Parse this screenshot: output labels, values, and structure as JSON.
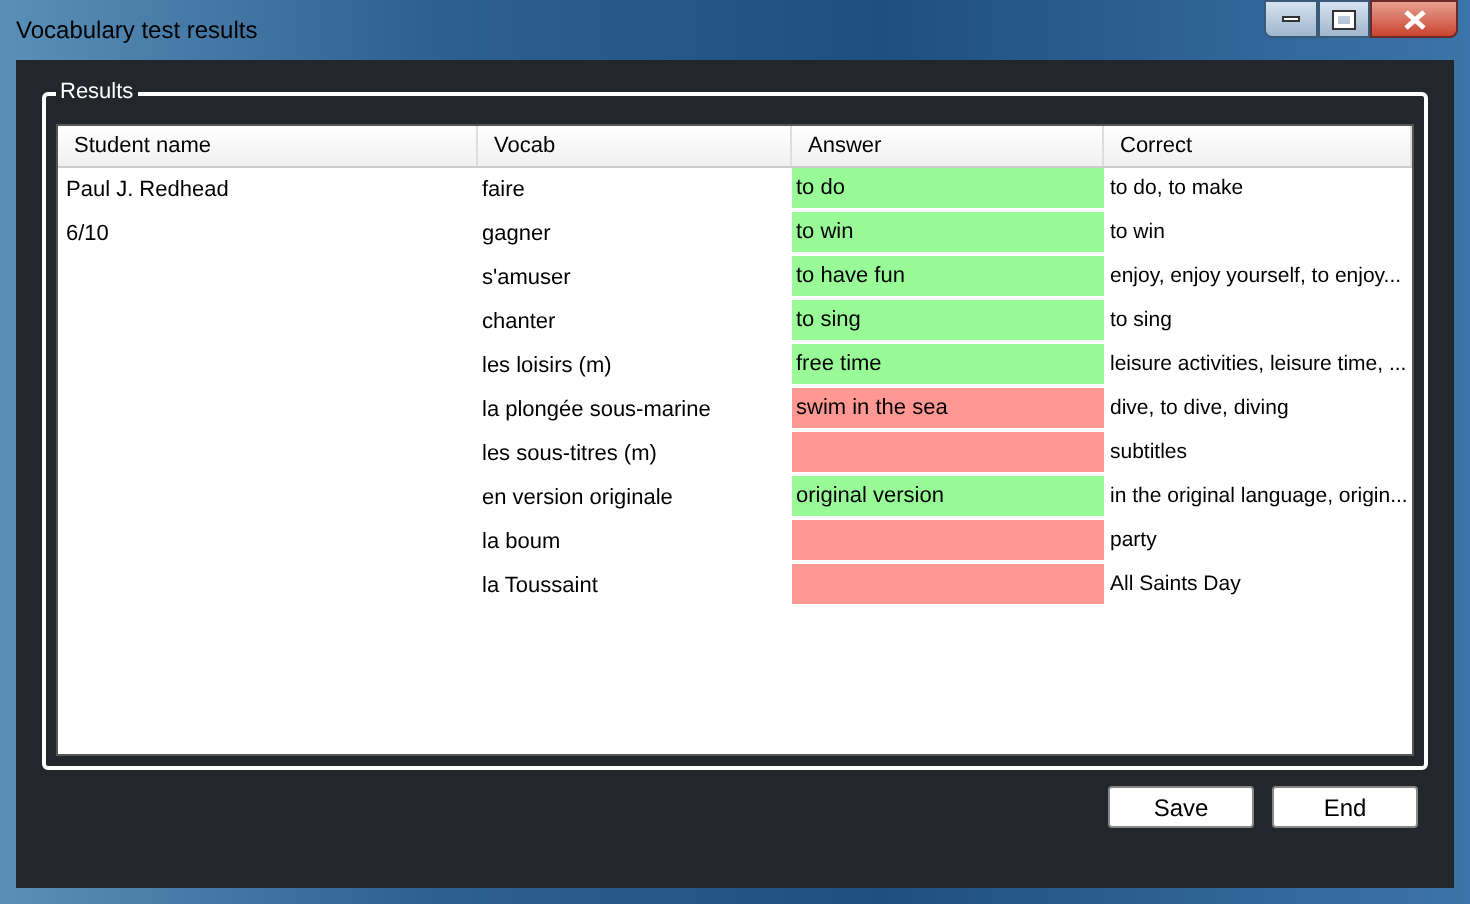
{
  "window": {
    "title": "Vocabulary test results"
  },
  "group": {
    "label": "Results"
  },
  "table": {
    "columns": [
      "Student name",
      "Vocab",
      "Answer",
      "Correct"
    ],
    "rows": [
      {
        "student": "Paul J. Redhead",
        "vocab": "faire",
        "answer": "to do",
        "correct": true,
        "expected": "to do, to make"
      },
      {
        "student": "6/10",
        "vocab": "gagner",
        "answer": "to win",
        "correct": true,
        "expected": "to win"
      },
      {
        "vocab": "s'amuser",
        "answer": "to have fun",
        "correct": true,
        "expected": "enjoy, enjoy yourself, to enjoy..."
      },
      {
        "vocab": "chanter",
        "answer": "to sing",
        "correct": true,
        "expected": "to sing"
      },
      {
        "vocab": "les loisirs (m)",
        "answer": "free time",
        "correct": true,
        "expected": "leisure activities, leisure time, ..."
      },
      {
        "vocab": "la plongée sous-marine",
        "answer": "swim in the sea",
        "correct": false,
        "expected": "dive, to dive, diving"
      },
      {
        "vocab": "les sous-titres (m)",
        "correct": false,
        "expected": "subtitles"
      },
      {
        "vocab": "en version originale",
        "answer": "original version",
        "correct": true,
        "expected": "in the original language, origin..."
      },
      {
        "vocab": "la boum",
        "correct": false,
        "expected": "party"
      },
      {
        "vocab": "la Toussaint",
        "correct": false,
        "expected": "All Saints Day"
      }
    ]
  },
  "buttons": [
    "Save",
    "End"
  ]
}
